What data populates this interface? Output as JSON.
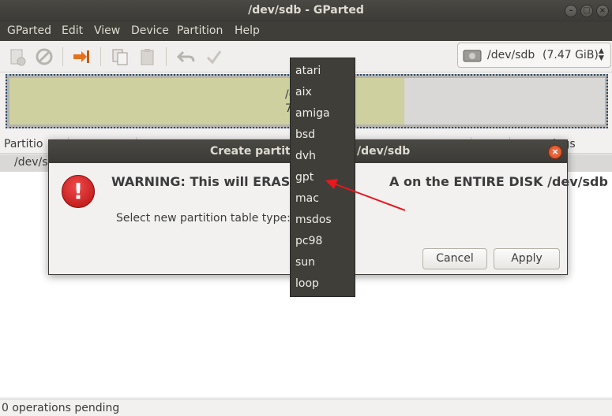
{
  "window": {
    "title": "/dev/sdb - GParted"
  },
  "menubar": [
    "GParted",
    "Edit",
    "View",
    "Device",
    "Partition",
    "Help"
  ],
  "device_selector": {
    "name": "/dev/sdb",
    "size": "(7.47 GiB)"
  },
  "diskmap": {
    "fragment1": "/c",
    "fragment2": "7"
  },
  "table": {
    "headers": {
      "partition": "Partitio",
      "flags": "lags"
    },
    "row": "/dev/sd"
  },
  "status": "0 operations pending",
  "dialog": {
    "title": "Create partitio",
    "title_suffix": "/dev/sdb",
    "warning": "WARNING: This will ERASE",
    "warning_suffix": "A on the ENTIRE DISK /dev/sdb",
    "select_label": "Select new partition table type:",
    "cancel": "Cancel",
    "apply": "Apply"
  },
  "popup": {
    "options": [
      "atari",
      "aix",
      "amiga",
      "bsd",
      "dvh",
      "gpt",
      "mac",
      "msdos",
      "pc98",
      "sun",
      "loop"
    ]
  },
  "colors": {
    "annotation_arrow": "#e8191e",
    "partition_fill": "#cfd09f"
  }
}
